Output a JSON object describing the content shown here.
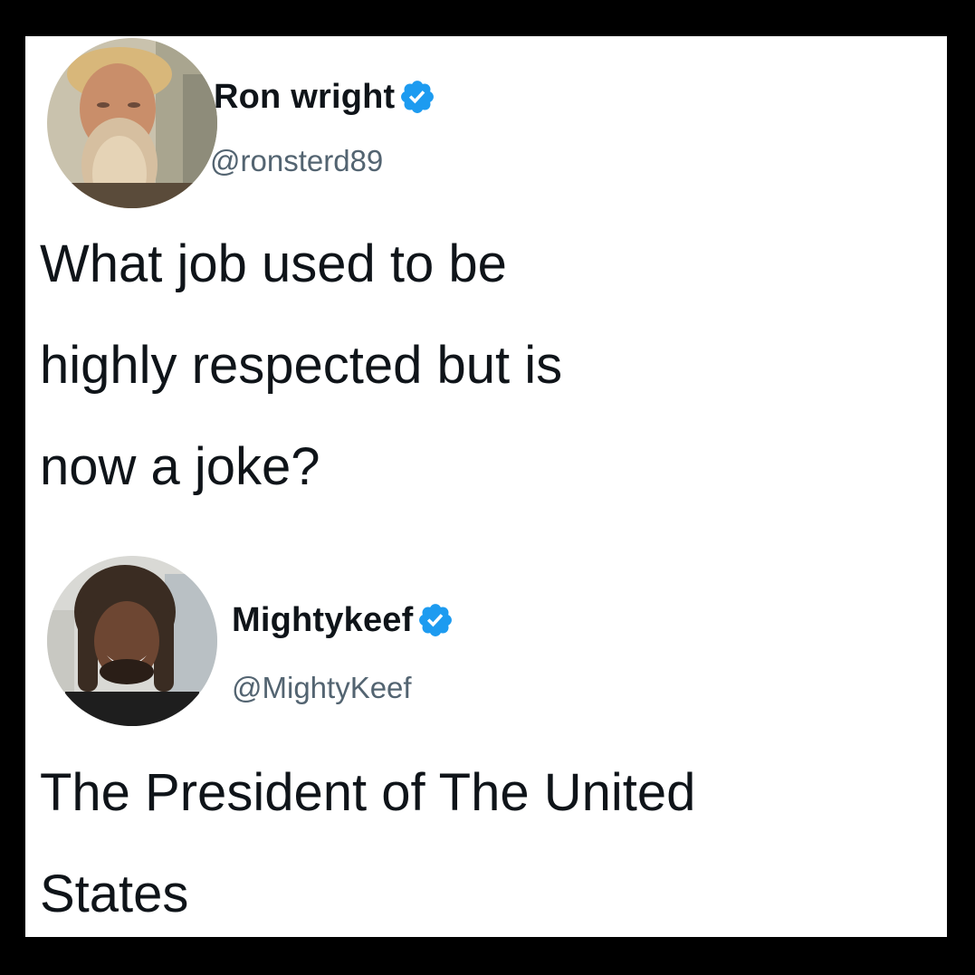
{
  "colors": {
    "border": "#000000",
    "card_background": "#ffffff",
    "text_primary": "#0f1419",
    "text_secondary": "#536471",
    "verified_badge": "#1d9bf0"
  },
  "tweets": [
    {
      "display_name": "Ron wright",
      "handle": "@ronsterd89",
      "verified": true,
      "avatar_icon": "bearded-man-avatar",
      "body_lines": [
        "What job used to be",
        "highly respected but is",
        "now a joke?"
      ]
    },
    {
      "display_name": "Mightykeef",
      "handle": "@MightyKeef",
      "verified": true,
      "avatar_icon": "smiling-man-dreadlocks-avatar",
      "body_lines": [
        "The President of The United",
        "States"
      ]
    }
  ]
}
